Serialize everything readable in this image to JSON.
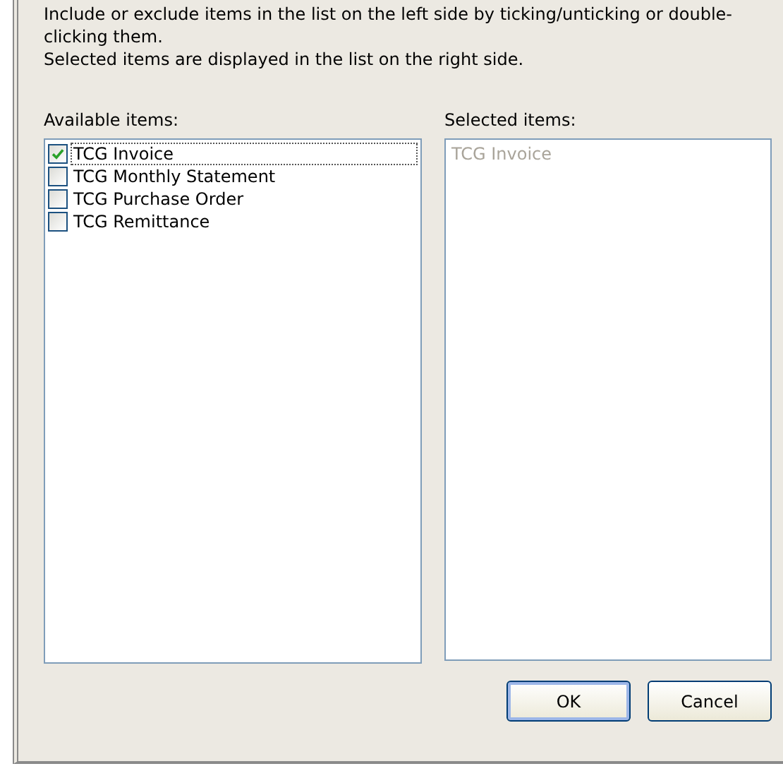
{
  "instructions": [
    "Include or exclude items in the list on the left side by ticking/unticking or double-clicking them.",
    "Selected items are displayed in the list on the right side."
  ],
  "available": {
    "label": "Available items:",
    "items": [
      {
        "label": "TCG Invoice",
        "checked": true,
        "focused": true
      },
      {
        "label": "TCG Monthly Statement",
        "checked": false,
        "focused": false
      },
      {
        "label": "TCG Purchase Order",
        "checked": false,
        "focused": false
      },
      {
        "label": "TCG Remittance",
        "checked": false,
        "focused": false
      }
    ]
  },
  "selected": {
    "label": "Selected items:",
    "items": [
      {
        "label": "TCG Invoice",
        "disabled": true
      }
    ]
  },
  "buttons": [
    {
      "label": "OK",
      "default": true
    },
    {
      "label": "Cancel",
      "default": false
    }
  ]
}
